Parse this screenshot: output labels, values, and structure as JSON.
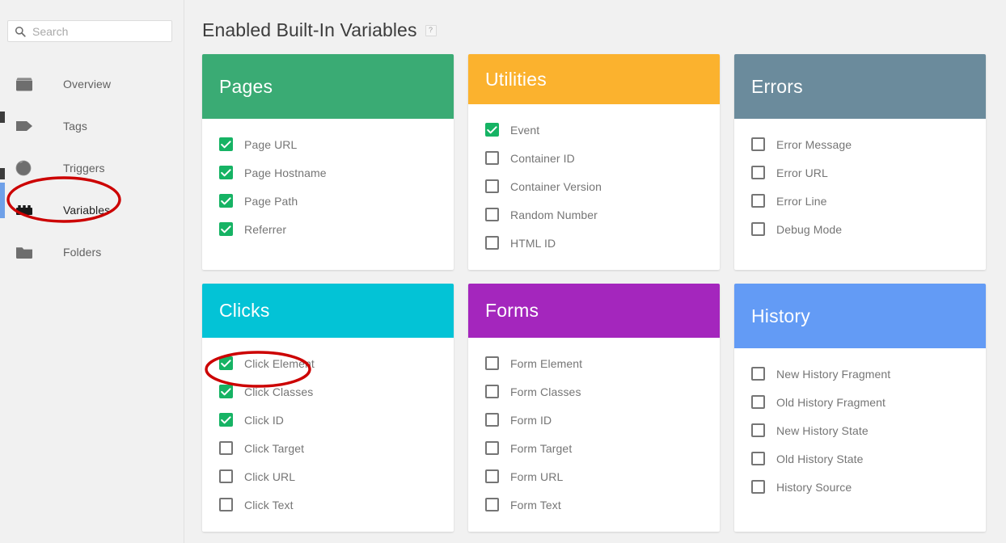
{
  "sidebar": {
    "search": {
      "placeholder": "Search",
      "value": "",
      "icon": "search-icon"
    },
    "items": [
      {
        "label": "Overview",
        "icon": "overview-box-icon",
        "active": false
      },
      {
        "label": "Tags",
        "icon": "tag-icon",
        "active": false
      },
      {
        "label": "Triggers",
        "icon": "trigger-circle-icon",
        "active": false
      },
      {
        "label": "Variables",
        "icon": "variables-brick-icon",
        "active": true
      },
      {
        "label": "Folders",
        "icon": "folder-icon",
        "active": false
      }
    ],
    "active_indicator_color": "#6fa0e8"
  },
  "main": {
    "title": "Enabled Built-In Variables",
    "help_badge": "?",
    "cards": [
      {
        "title": "Pages",
        "color": "#3aab74",
        "height_class": "h1",
        "options": [
          {
            "label": "Page URL",
            "checked": true
          },
          {
            "label": "Page Hostname",
            "checked": true
          },
          {
            "label": "Page Path",
            "checked": true
          },
          {
            "label": "Referrer",
            "checked": true
          }
        ]
      },
      {
        "title": "Utilities",
        "color": "#fbb22e",
        "height_class": "h1",
        "options": [
          {
            "label": "Event",
            "checked": true
          },
          {
            "label": "Container ID",
            "checked": false
          },
          {
            "label": "Container Version",
            "checked": false
          },
          {
            "label": "Random Number",
            "checked": false
          },
          {
            "label": "HTML ID",
            "checked": false
          }
        ]
      },
      {
        "title": "Errors",
        "color": "#6b8b9c",
        "height_class": "h1",
        "options": [
          {
            "label": "Error Message",
            "checked": false
          },
          {
            "label": "Error URL",
            "checked": false
          },
          {
            "label": "Error Line",
            "checked": false
          },
          {
            "label": "Debug Mode",
            "checked": false
          }
        ]
      },
      {
        "title": "Clicks",
        "color": "#03c3d6",
        "height_class": "h2",
        "options": [
          {
            "label": "Click Element",
            "checked": true
          },
          {
            "label": "Click Classes",
            "checked": true
          },
          {
            "label": "Click ID",
            "checked": true
          },
          {
            "label": "Click Target",
            "checked": false
          },
          {
            "label": "Click URL",
            "checked": false
          },
          {
            "label": "Click Text",
            "checked": false
          }
        ]
      },
      {
        "title": "Forms",
        "color": "#a426bd",
        "height_class": "h2",
        "options": [
          {
            "label": "Form Element",
            "checked": false
          },
          {
            "label": "Form Classes",
            "checked": false
          },
          {
            "label": "Form ID",
            "checked": false
          },
          {
            "label": "Form Target",
            "checked": false
          },
          {
            "label": "Form URL",
            "checked": false
          },
          {
            "label": "Form Text",
            "checked": false
          }
        ]
      },
      {
        "title": "History",
        "color": "#639bf5",
        "height_class": "h2",
        "options": [
          {
            "label": "New History Fragment",
            "checked": false
          },
          {
            "label": "Old History Fragment",
            "checked": false
          },
          {
            "label": "New History State",
            "checked": false
          },
          {
            "label": "Old History State",
            "checked": false
          },
          {
            "label": "History Source",
            "checked": false
          }
        ]
      }
    ]
  },
  "annotations": {
    "color": "#cc0000",
    "items": [
      {
        "target": "sidebar-item-variables",
        "shape": "ellipse"
      },
      {
        "target": "option-click-element",
        "shape": "ellipse"
      }
    ]
  },
  "theme": {
    "page_background": "#f1f1f1",
    "card_background": "#ffffff",
    "checkbox_checked": "#16b364",
    "checkbox_border": "#757575",
    "text_muted": "#757575"
  }
}
